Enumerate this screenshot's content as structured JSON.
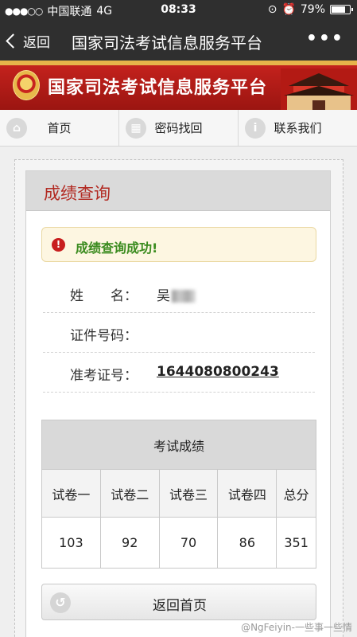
{
  "status_bar": {
    "signal_dots": "●●●○○",
    "carrier": "中国联通",
    "network": "4G",
    "time": "08:33",
    "battery": "79%",
    "battery_level": 0.79
  },
  "nav": {
    "back_label": "返回",
    "title": "国家司法考试信息服务平台",
    "more": "•••"
  },
  "banner": {
    "title": "国家司法考试信息服务平台"
  },
  "menu": [
    {
      "label": "首页",
      "icon": "home-icon"
    },
    {
      "label": "密码找回",
      "icon": "grid-icon"
    },
    {
      "label": "联系我们",
      "icon": "info-icon"
    }
  ],
  "card": {
    "title": "成绩查询"
  },
  "alert": {
    "message": "成绩查询成功!"
  },
  "fields": {
    "name_label": "姓　　名：",
    "name_value": "吴",
    "id_label": "证件号码：",
    "id_value": "",
    "ticket_label": "准考证号：",
    "ticket_value": "1644080800243"
  },
  "scores": {
    "caption": "考试成绩",
    "headers": [
      "试卷一",
      "试卷二",
      "试卷三",
      "试卷四",
      "总分"
    ],
    "values": [
      "103",
      "92",
      "70",
      "86",
      "351"
    ]
  },
  "home_button": {
    "label": "返回首页"
  },
  "watermark": "@NgFeiyin-一些事一些情",
  "colors": {
    "bar_bg": "#2f2f2f",
    "banner_red": "#c8231e",
    "heading_red": "#b22a22",
    "success_green": "#3a8b1e"
  }
}
